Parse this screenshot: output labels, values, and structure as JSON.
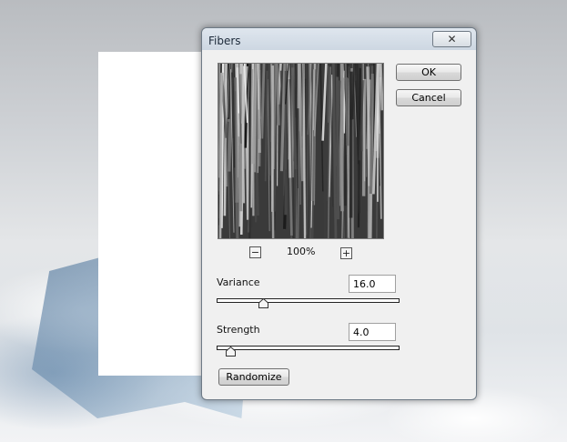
{
  "dialog": {
    "title": "Fibers",
    "close_glyph": "✕",
    "ok_label": "OK",
    "cancel_label": "Cancel",
    "zoom": {
      "value": "100%",
      "minus_glyph": "−",
      "plus_glyph": "+"
    },
    "variance": {
      "label": "Variance",
      "value": "16.0",
      "slider_fraction": 0.24
    },
    "strength": {
      "label": "Strength",
      "value": "4.0",
      "slider_fraction": 0.05
    },
    "randomize_label": "Randomize"
  },
  "icons": {
    "close": "close-icon",
    "zoom_out": "minus-icon",
    "zoom_in": "plus-icon",
    "slider_thumb": "triangle-thumb-icon"
  }
}
